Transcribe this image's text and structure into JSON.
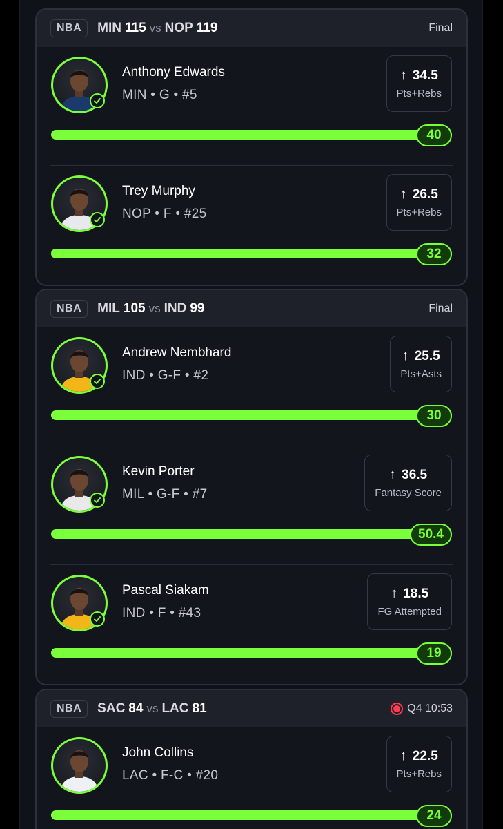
{
  "games": [
    {
      "league": "NBA",
      "away_team": "MIN",
      "away_score": "115",
      "vs": "vs",
      "home_team": "NOP",
      "home_score": "119",
      "status": "Final",
      "live": false,
      "players": [
        {
          "name": "Anthony Edwards",
          "meta": "MIN • G • #5",
          "line": "34.5",
          "stat": "Pts+Rebs",
          "result": "40",
          "jersey_color": "#1b3a6b"
        },
        {
          "name": "Trey Murphy",
          "meta": "NOP • F • #25",
          "line": "26.5",
          "stat": "Pts+Rebs",
          "result": "32",
          "jersey_color": "#e8e8ee"
        }
      ]
    },
    {
      "league": "NBA",
      "away_team": "MIL",
      "away_score": "105",
      "vs": "vs",
      "home_team": "IND",
      "home_score": "99",
      "status": "Final",
      "live": false,
      "players": [
        {
          "name": "Andrew Nembhard",
          "meta": "IND • G-F • #2",
          "line": "25.5",
          "stat": "Pts+Asts",
          "result": "30",
          "jersey_color": "#f2b619"
        },
        {
          "name": "Kevin Porter",
          "meta": "MIL • G-F • #7",
          "line": "36.5",
          "stat": "Fantasy Score",
          "result": "50.4",
          "jersey_color": "#e9e9ec"
        },
        {
          "name": "Pascal Siakam",
          "meta": "IND • F • #43",
          "line": "18.5",
          "stat": "FG Attempted",
          "result": "19",
          "jersey_color": "#f2b619"
        }
      ]
    },
    {
      "league": "NBA",
      "away_team": "SAC",
      "away_score": "84",
      "vs": "vs",
      "home_team": "LAC",
      "home_score": "81",
      "status": "Q4 10:53",
      "live": true,
      "players": [
        {
          "name": "John Collins",
          "meta": "LAC • F-C • #20",
          "line": "22.5",
          "stat": "Pts+Rebs",
          "result": "24",
          "jersey_color": "#eef0f4"
        }
      ]
    }
  ],
  "colors": {
    "accent": "#7bff3a",
    "live": "#ff3b4e",
    "card_bg": "#13151d",
    "header_bg": "#1e2129"
  },
  "icons": {
    "check": "check-icon",
    "arrow": "arrow-up-icon",
    "live": "live-dot-icon"
  }
}
